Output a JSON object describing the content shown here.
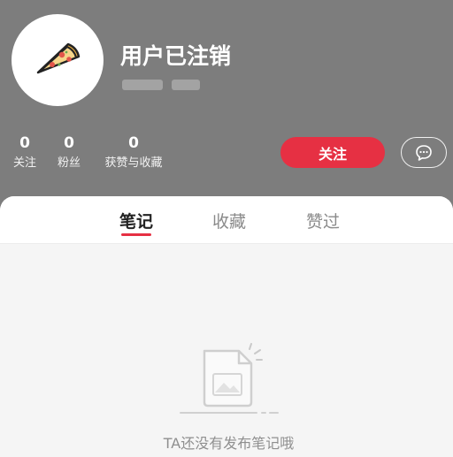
{
  "profile": {
    "username": "用户已注销",
    "avatar_icon": "pizza-icon"
  },
  "stats": [
    {
      "value": "0",
      "label": "关注"
    },
    {
      "value": "0",
      "label": "粉丝"
    },
    {
      "value": "0",
      "label": "获赞与收藏"
    }
  ],
  "actions": {
    "follow_label": "关注",
    "message_icon": "chat-bubble-icon"
  },
  "tabs": [
    {
      "label": "笔记",
      "active": true
    },
    {
      "label": "收藏",
      "active": false
    },
    {
      "label": "赞过",
      "active": false
    }
  ],
  "empty_state": {
    "message": "TA还没有发布笔记哦",
    "icon": "empty-note-icon"
  },
  "colors": {
    "header_bg": "#7d7d7d",
    "accent": "#e63043"
  }
}
